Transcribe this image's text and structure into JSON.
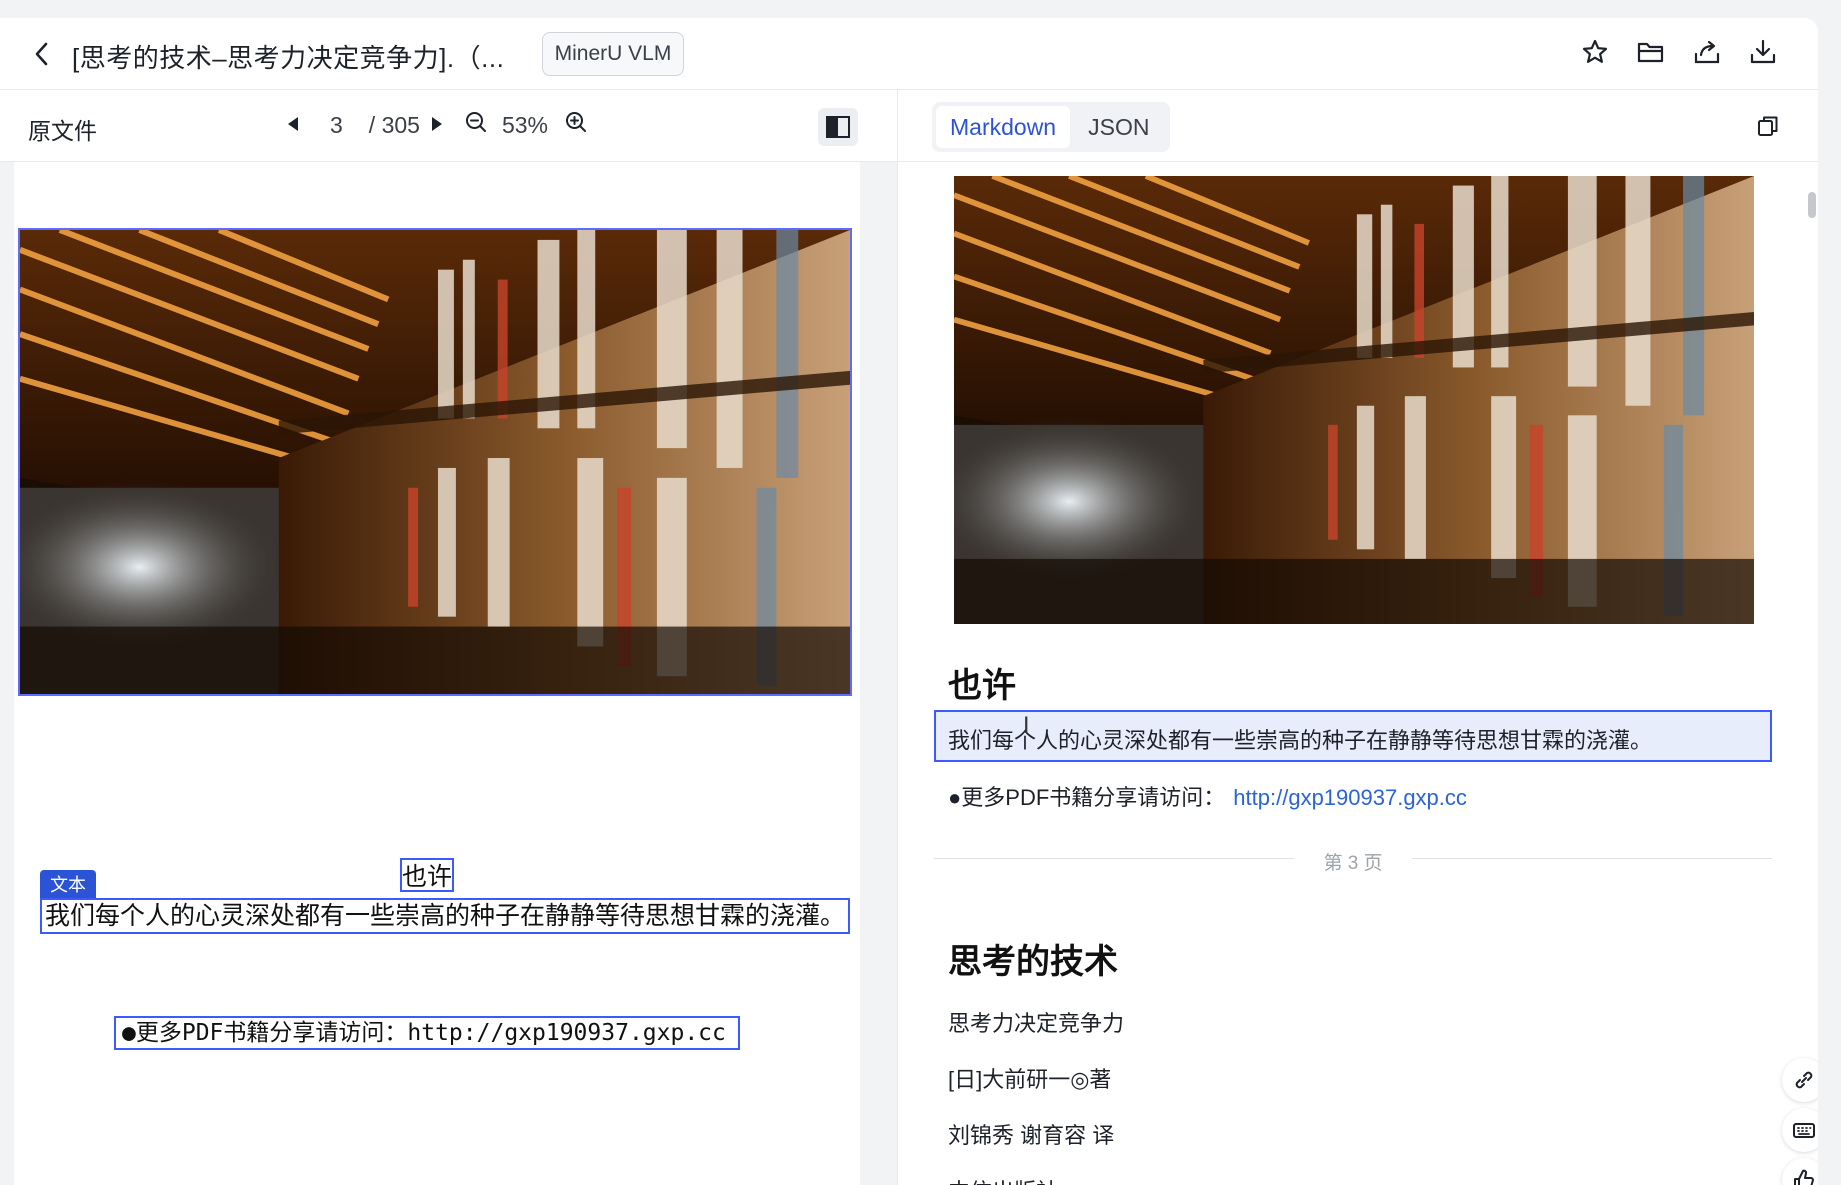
{
  "header": {
    "title": "[思考的技术–思考力决定竞争力].（...",
    "model_badge": "MinerU VLM",
    "icons": [
      "back-icon",
      "star-icon",
      "folder-icon",
      "share-icon",
      "download-icon"
    ]
  },
  "left_toolbar": {
    "label": "原文件",
    "page_current": "3",
    "page_total": "/ 305",
    "zoom": "53%"
  },
  "right_toolbar": {
    "tabs": [
      {
        "label": "Markdown",
        "active": true
      },
      {
        "label": "JSON",
        "active": false
      }
    ]
  },
  "pdf": {
    "heading": "也许",
    "tag": "文本",
    "paragraph": "我们每个人的心灵深处都有一些崇高的种子在静静等待思想甘霖的浇灌。",
    "link_line": "●更多PDF书籍分享请访问：http://gxp190937.gxp.cc"
  },
  "markdown": {
    "heading": "也许",
    "paragraph": "我们每个人的心灵深处都有一些崇高的种子在静静等待思想甘霖的浇灌。",
    "link_prefix": "●更多PDF书籍分享请访问：",
    "link_url": "http://gxp190937.gxp.cc",
    "page_sep": "第 3 页",
    "title2": "思考的技术",
    "lines": [
      "思考力决定竞争力",
      "[日]大前研一◎著",
      "刘锦秀 谢育容 译",
      "中信出版社"
    ]
  },
  "colors": {
    "accent": "#2b53d6",
    "highlight_border": "#3d5afe",
    "highlight_fill": "#e8edfb",
    "link": "#2b63d9"
  }
}
